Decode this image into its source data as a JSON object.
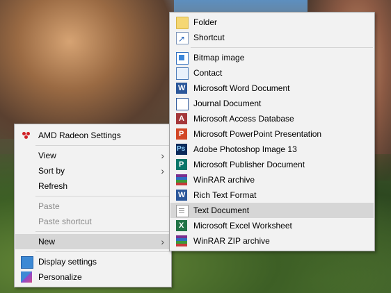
{
  "context_menu": {
    "items": [
      {
        "label": "AMD Radeon Settings",
        "icon": "amd-icon"
      },
      {
        "label": "View"
      },
      {
        "label": "Sort by"
      },
      {
        "label": "Refresh"
      },
      {
        "label": "Paste",
        "disabled": true
      },
      {
        "label": "Paste shortcut",
        "disabled": true
      },
      {
        "label": "New",
        "highlighted": true
      },
      {
        "label": "Display settings",
        "icon": "display-icon"
      },
      {
        "label": "Personalize",
        "icon": "personalize-icon"
      }
    ],
    "submenu_arrow": "›"
  },
  "new_submenu": {
    "items": [
      {
        "label": "Folder",
        "icon": "folder-icon"
      },
      {
        "label": "Shortcut",
        "icon": "shortcut-icon"
      },
      {
        "label": "Bitmap image",
        "icon": "bitmap-icon"
      },
      {
        "label": "Contact",
        "icon": "contact-icon"
      },
      {
        "label": "Microsoft Word Document",
        "icon": "word-icon"
      },
      {
        "label": "Journal Document",
        "icon": "journal-icon"
      },
      {
        "label": "Microsoft Access Database",
        "icon": "access-icon"
      },
      {
        "label": "Microsoft PowerPoint Presentation",
        "icon": "powerpoint-icon"
      },
      {
        "label": "Adobe Photoshop Image 13",
        "icon": "photoshop-icon"
      },
      {
        "label": "Microsoft Publisher Document",
        "icon": "publisher-icon"
      },
      {
        "label": "WinRAR archive",
        "icon": "winrar-icon"
      },
      {
        "label": "Rich Text Format",
        "icon": "rtf-icon"
      },
      {
        "label": "Text Document",
        "icon": "text-document-icon",
        "highlighted": true
      },
      {
        "label": "Microsoft Excel Worksheet",
        "icon": "excel-icon"
      },
      {
        "label": "WinRAR ZIP archive",
        "icon": "winrar-zip-icon"
      }
    ]
  },
  "colors": {
    "menu_bg": "#f2f2f2",
    "highlight": "#d6d6d6",
    "disabled_text": "#8a8a8a"
  }
}
